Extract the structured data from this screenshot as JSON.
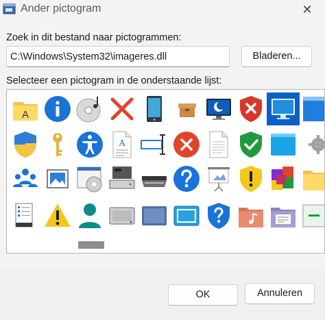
{
  "window": {
    "title": "Ander pictogram",
    "close_glyph": "✕"
  },
  "file_section": {
    "label": "Zoek in dit bestand naar pictogrammen:",
    "path_value": "C:\\Windows\\System32\\imageres.dll",
    "browse_label": "Bladeren..."
  },
  "list_section": {
    "label": "Selecteer een pictogram in de onderstaande lijst:"
  },
  "icons": [
    "folder-a-icon",
    "info-icon",
    "cd-music-icon",
    "red-x-icon",
    "tablet-device-icon",
    "box-icon",
    "monitor-moon-icon",
    "shield-x-icon",
    "monitor-blue-icon",
    "blue-panel-icon",
    "uac-shield-icon",
    "key-icon",
    "accessibility-icon",
    "document-a-icon",
    "text-cursor-icon",
    "error-icon",
    "blank-document-icon",
    "shield-check-icon",
    "blue-window-icon",
    "gear-icon",
    "users-icon",
    "picture-frame-icon",
    "cd-window-icon",
    "server-drive-icon",
    "scanner-icon",
    "help-icon",
    "projector-screen-icon",
    "shield-warning-icon",
    "programs-icon",
    "folder-yellow-icon",
    "server-list-icon",
    "warning-icon",
    "user-icon",
    "drive-gray-icon",
    "drive-blue-icon",
    "disk-blue-icon",
    "shield-question-icon",
    "music-folder-icon",
    "news-folder-icon",
    "green-window-icon"
  ],
  "selected_icon": "monitor-blue-icon",
  "buttons": {
    "ok_label": "OK",
    "cancel_label": "Annuleren"
  }
}
